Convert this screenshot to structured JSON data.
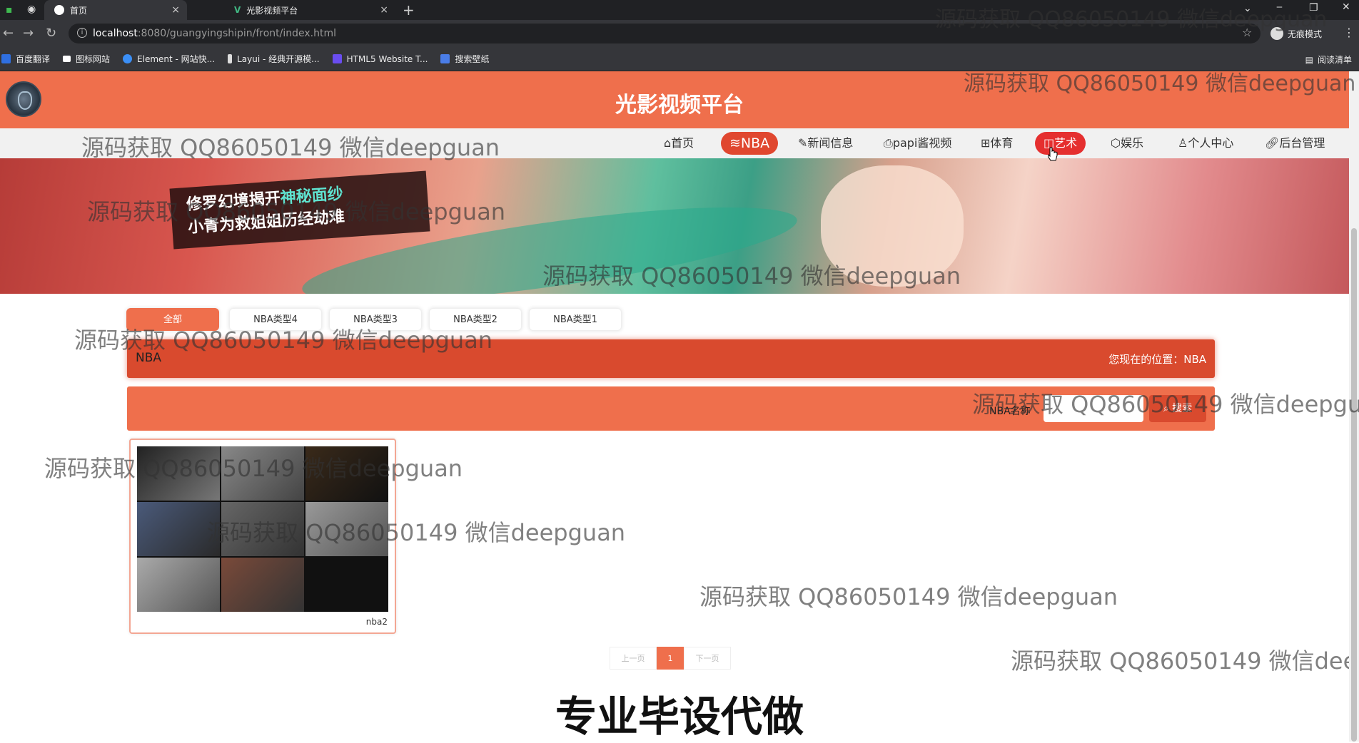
{
  "browser": {
    "tabs": [
      {
        "label": "首页"
      },
      {
        "label": "光影视频平台"
      }
    ],
    "url_host": "localhost",
    "url_path": ":8080/guangyingshipin/front/index.html",
    "incognito_label": "无痕模式",
    "bookmarks": [
      {
        "label": "百度翻译",
        "color": "#2f6fe0"
      },
      {
        "label": "图标网站",
        "color": "#ffffff"
      },
      {
        "label": "Element - 网站快...",
        "color": "#3b8ff6"
      },
      {
        "label": "Layui - 经典开源模...",
        "color": "#dddddd"
      },
      {
        "label": "HTML5 Website T...",
        "color": "#6a4df0"
      },
      {
        "label": "搜索壁纸",
        "color": "#4a7de8"
      }
    ],
    "reading_list": "阅读清单"
  },
  "site": {
    "title": "光影视频平台",
    "nav": [
      {
        "label": "首页",
        "icon": "home-icon"
      },
      {
        "label": "NBA",
        "icon": "layers-icon"
      },
      {
        "label": "新闻信息",
        "icon": "edit-icon"
      },
      {
        "label": "papi酱视频",
        "icon": "printer-icon"
      },
      {
        "label": "体育",
        "icon": "grid-icon"
      },
      {
        "label": "艺术",
        "icon": "palette-icon"
      },
      {
        "label": "娱乐",
        "icon": "cube-icon"
      },
      {
        "label": "个人中心",
        "icon": "user-icon"
      },
      {
        "label": "后台管理",
        "icon": "link-icon"
      }
    ],
    "banner_caption": [
      "修罗幻境揭开",
      "神秘面纱",
      "小青为救姐姐历经劫难"
    ]
  },
  "content": {
    "filter_tabs": [
      "全部",
      "NBA类型4",
      "NBA类型3",
      "NBA类型2",
      "NBA类型1"
    ],
    "category": "NBA",
    "location": "您现在的位置：NBA",
    "search_label": "NBA名称",
    "search_button": "搜索",
    "video_name": "nba2",
    "pager": {
      "prev": "上一页",
      "current": "1",
      "next": "下一页"
    }
  },
  "overlay": {
    "watermark": "源码获取 QQ86050149 微信deepguan",
    "bottom_caption": "专业毕设代做"
  },
  "colors": {
    "header": "#ef6f4c",
    "accent": "#d94a2e"
  }
}
